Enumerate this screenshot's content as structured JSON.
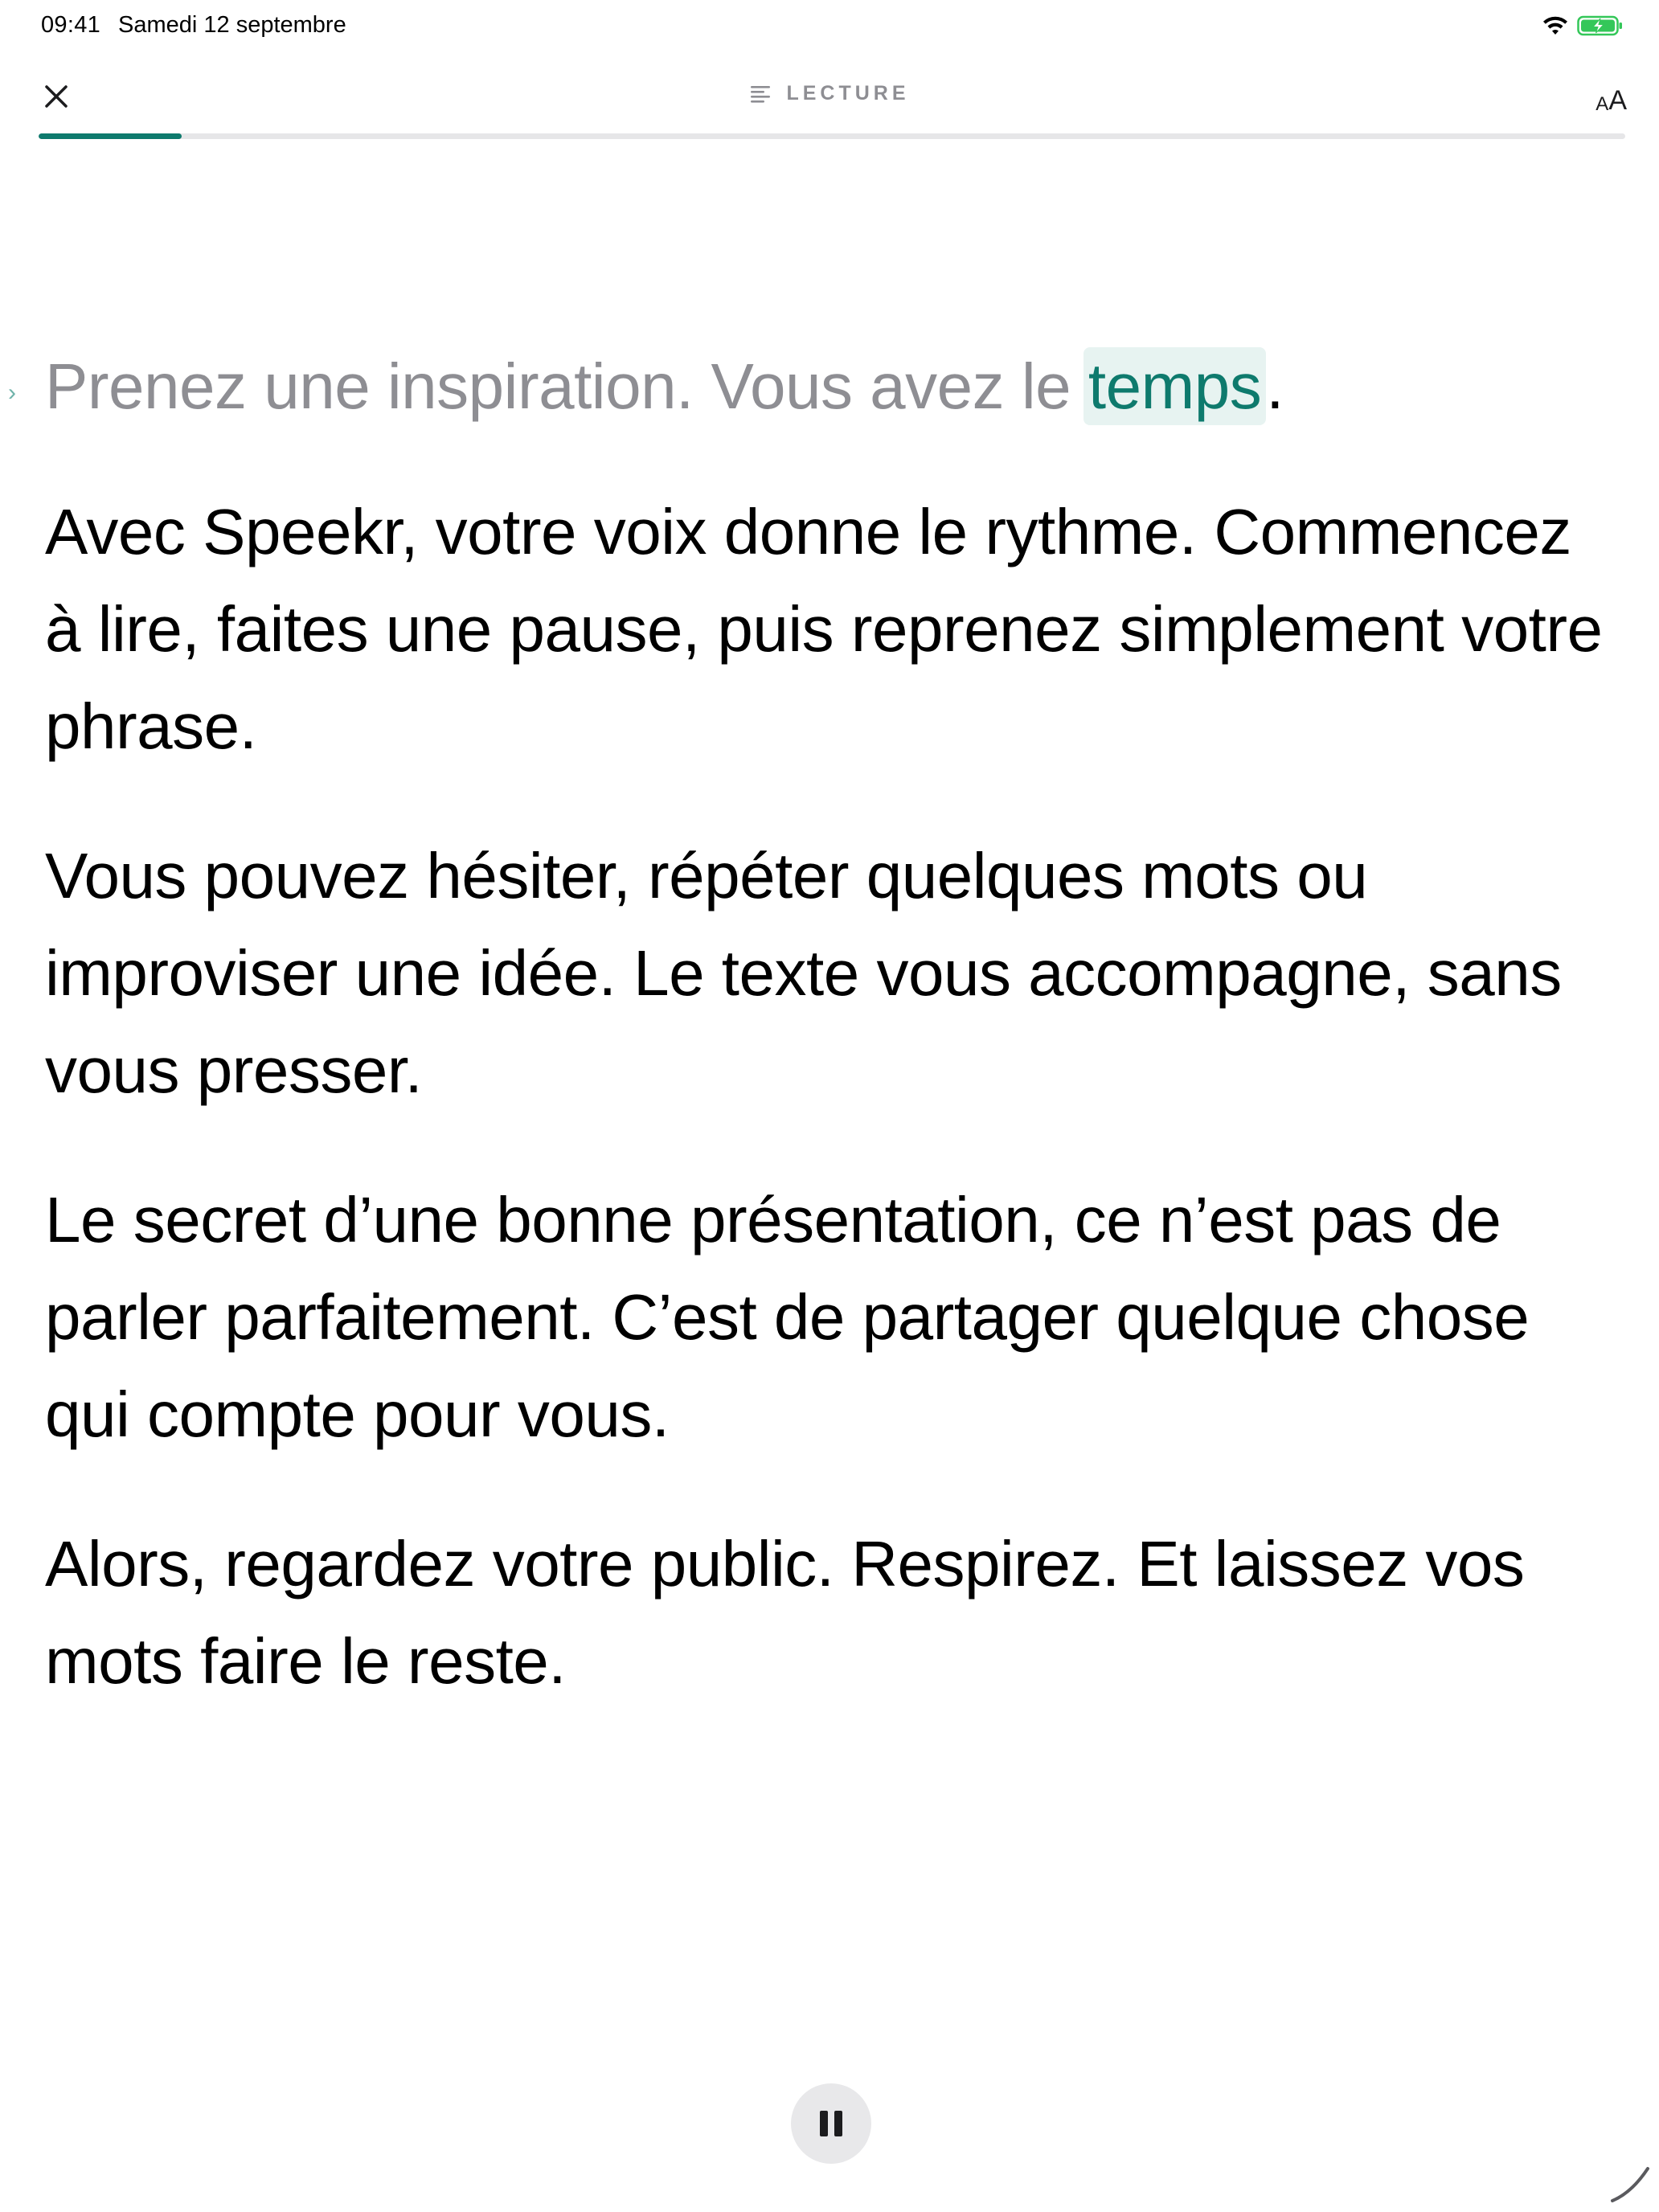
{
  "status_bar": {
    "time": "09:41",
    "date": "Samedi 12 septembre",
    "wifi_icon": "wifi-icon",
    "battery_icon": "battery-charging-icon",
    "battery_color": "#34c759"
  },
  "nav": {
    "close_icon": "close-icon",
    "mode_icon": "text-lines-icon",
    "title": "LECTURE",
    "font_size_small": "A",
    "font_size_large": "A"
  },
  "progress": {
    "fraction": 0.09,
    "color": "#0e7a6d"
  },
  "reader": {
    "current_sentence_before": "Prenez une inspiration. Vous avez le ",
    "current_word": "temps",
    "current_sentence_after": ".",
    "paragraphs": [
      "Avec Speekr, votre voix donne le rythme. Commencez à lire, faites une pause, puis reprenez simplement votre phrase.",
      "Vous pouvez hésiter, répéter quelques mots ou improviser une idée. Le texte vous accompagne, sans vous presser.",
      "Le secret d’une bonne présentation, ce n’est pas de parler parfaitement. C’est de partager quelque chose qui compte pour vous.",
      "Alors, regardez votre public. Respirez. Et laissez vos mots faire le reste."
    ],
    "accent_color": "#0e7a6d"
  },
  "controls": {
    "pause_icon": "pause-icon"
  }
}
